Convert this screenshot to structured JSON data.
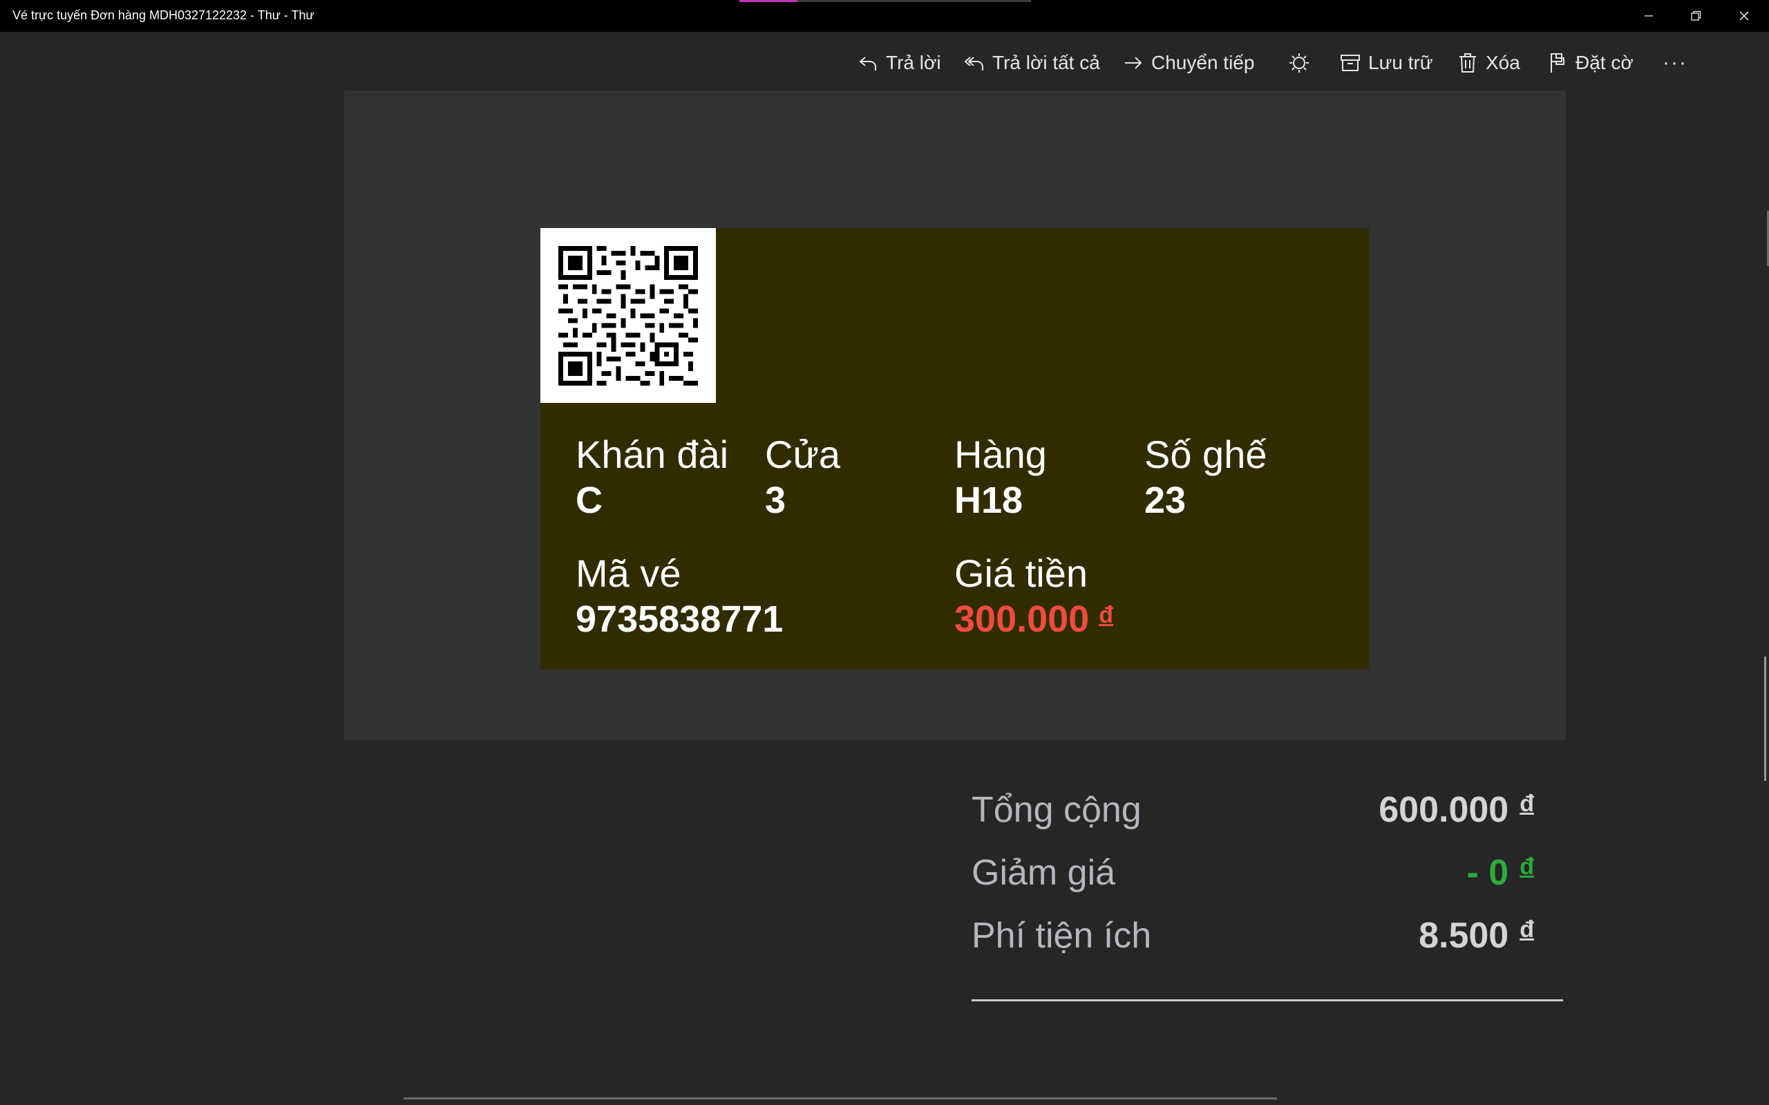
{
  "window": {
    "title": "Vé trực tuyến Đơn hàng MDH0327122232 - Thư - Thư",
    "accent_color": "#c239b3"
  },
  "toolbar": {
    "reply": "Trả lời",
    "reply_all": "Trả lời tất cả",
    "forward": "Chuyển tiếp",
    "archive": "Lưu trữ",
    "delete": "Xóa",
    "flag": "Đặt cờ",
    "more": "···"
  },
  "ticket": {
    "background_color": "#312c00",
    "stand_label": "Khán đài",
    "stand_value": "C",
    "gate_label": "Cửa",
    "gate_value": "3",
    "row_label": "Hàng",
    "row_value": "H18",
    "seat_label": "Số ghế",
    "seat_value": "23",
    "code_label": "Mã vé",
    "code_value": "9735838771",
    "price_label": "Giá tiền",
    "price_value": "300.000",
    "price_currency": "đ",
    "price_color": "#f04b3c"
  },
  "summary": {
    "total_label": "Tổng cộng",
    "total_value": "600.000",
    "discount_label": "Giảm giá",
    "discount_value": "- 0",
    "fee_label": "Phí tiện ích",
    "fee_value": "8.500",
    "currency": "đ",
    "discount_color": "#2bab3a"
  }
}
